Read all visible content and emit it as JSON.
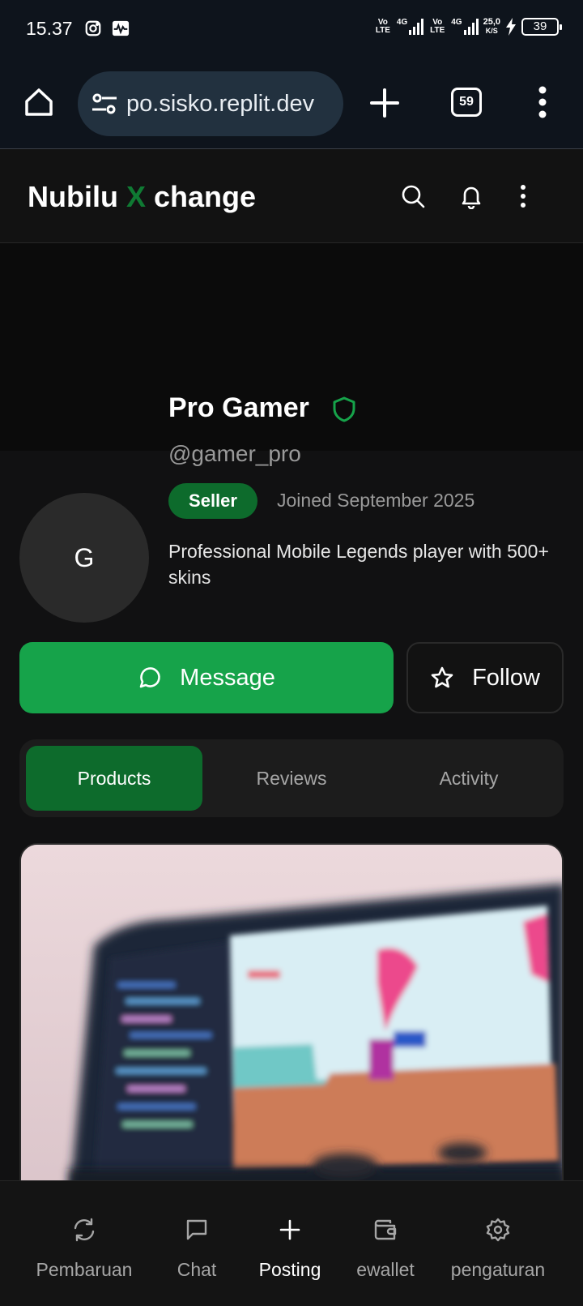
{
  "status_bar": {
    "time": "15.37",
    "network_1": "Vo LTE",
    "network_type_1": "4G",
    "network_2": "Vo LTE",
    "network_type_2": "4G",
    "speed_value": "25,0",
    "speed_unit": "K/S",
    "battery": "39"
  },
  "browser": {
    "url": "po.sisko.replit.dev",
    "tab_count": "59"
  },
  "app": {
    "brand_part1": "Nubilu ",
    "brand_x": "X",
    "brand_part2": " change"
  },
  "profile": {
    "name": "Pro Gamer",
    "handle": "@gamer_pro",
    "avatar_initial": "G",
    "role_badge": "Seller",
    "joined": "Joined September 2025",
    "bio": "Professional Mobile Legends player with 500+ skins",
    "message_label": "Message",
    "follow_label": "Follow"
  },
  "tabs": [
    {
      "label": "Products",
      "active": true
    },
    {
      "label": "Reviews",
      "active": false
    },
    {
      "label": "Activity",
      "active": false
    }
  ],
  "bottom_nav": [
    {
      "label": "Pembaruan",
      "icon": "refresh-icon"
    },
    {
      "label": "Chat",
      "icon": "chat-icon"
    },
    {
      "label": "Posting",
      "icon": "plus-icon",
      "active": true
    },
    {
      "label": "ewallet",
      "icon": "wallet-icon"
    },
    {
      "label": "pengaturan",
      "icon": "gear-icon"
    }
  ],
  "colors": {
    "accent_green": "#16a34a",
    "dark_green": "#0d6b2c",
    "background": "#111112"
  }
}
